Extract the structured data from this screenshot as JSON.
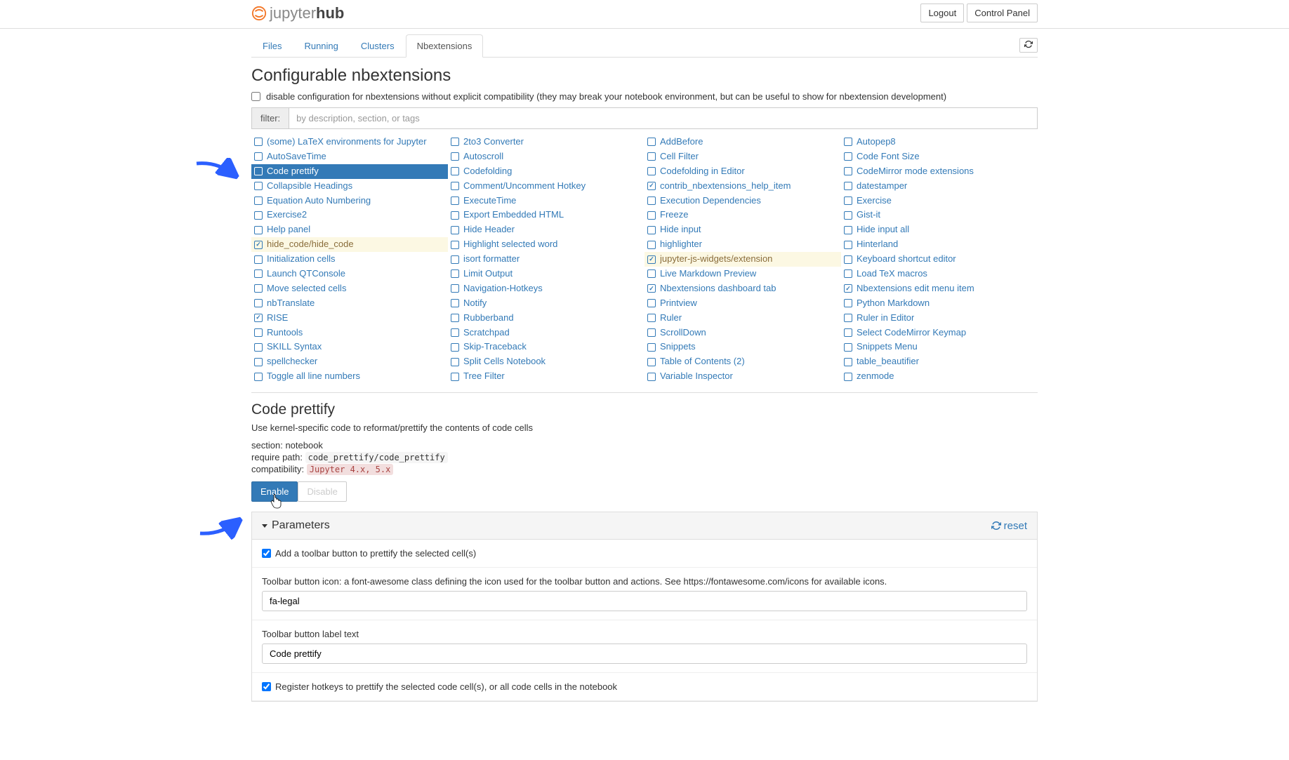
{
  "header": {
    "logo_prefix": "jupyter",
    "logo_suffix": "hub",
    "logout": "Logout",
    "control_panel": "Control Panel"
  },
  "tabs": [
    {
      "label": "Files",
      "active": false
    },
    {
      "label": "Running",
      "active": false
    },
    {
      "label": "Clusters",
      "active": false
    },
    {
      "label": "Nbextensions",
      "active": true
    }
  ],
  "page_title": "Configurable nbextensions",
  "compat_checkbox_label": "disable configuration for nbextensions without explicit compatibility (they may break your notebook environment, but can be useful to show for nbextension development)",
  "filter": {
    "label": "filter:",
    "placeholder": "by description, section, or tags"
  },
  "extensions": [
    {
      "name": "(some) LaTeX environments for Jupyter",
      "checked": false
    },
    {
      "name": "2to3 Converter",
      "checked": false
    },
    {
      "name": "AddBefore",
      "checked": false
    },
    {
      "name": "Autopep8",
      "checked": false
    },
    {
      "name": "AutoSaveTime",
      "checked": false
    },
    {
      "name": "Autoscroll",
      "checked": false
    },
    {
      "name": "Cell Filter",
      "checked": false
    },
    {
      "name": "Code Font Size",
      "checked": false
    },
    {
      "name": "Code prettify",
      "checked": false,
      "selected": true
    },
    {
      "name": "Codefolding",
      "checked": false
    },
    {
      "name": "Codefolding in Editor",
      "checked": false
    },
    {
      "name": "CodeMirror mode extensions",
      "checked": false
    },
    {
      "name": "Collapsible Headings",
      "checked": false
    },
    {
      "name": "Comment/Uncomment Hotkey",
      "checked": false
    },
    {
      "name": "contrib_nbextensions_help_item",
      "checked": true
    },
    {
      "name": "datestamper",
      "checked": false
    },
    {
      "name": "Equation Auto Numbering",
      "checked": false
    },
    {
      "name": "ExecuteTime",
      "checked": false
    },
    {
      "name": "Execution Dependencies",
      "checked": false
    },
    {
      "name": "Exercise",
      "checked": false
    },
    {
      "name": "Exercise2",
      "checked": false
    },
    {
      "name": "Export Embedded HTML",
      "checked": false
    },
    {
      "name": "Freeze",
      "checked": false
    },
    {
      "name": "Gist-it",
      "checked": false
    },
    {
      "name": "Help panel",
      "checked": false
    },
    {
      "name": "Hide Header",
      "checked": false
    },
    {
      "name": "Hide input",
      "checked": false
    },
    {
      "name": "Hide input all",
      "checked": false
    },
    {
      "name": "hide_code/hide_code",
      "checked": true,
      "highlight": true
    },
    {
      "name": "Highlight selected word",
      "checked": false
    },
    {
      "name": "highlighter",
      "checked": false
    },
    {
      "name": "Hinterland",
      "checked": false
    },
    {
      "name": "Initialization cells",
      "checked": false
    },
    {
      "name": "isort formatter",
      "checked": false
    },
    {
      "name": "jupyter-js-widgets/extension",
      "checked": true,
      "highlight": true
    },
    {
      "name": "Keyboard shortcut editor",
      "checked": false
    },
    {
      "name": "Launch QTConsole",
      "checked": false
    },
    {
      "name": "Limit Output",
      "checked": false
    },
    {
      "name": "Live Markdown Preview",
      "checked": false
    },
    {
      "name": "Load TeX macros",
      "checked": false
    },
    {
      "name": "Move selected cells",
      "checked": false
    },
    {
      "name": "Navigation-Hotkeys",
      "checked": false
    },
    {
      "name": "Nbextensions dashboard tab",
      "checked": true
    },
    {
      "name": "Nbextensions edit menu item",
      "checked": true
    },
    {
      "name": "nbTranslate",
      "checked": false
    },
    {
      "name": "Notify",
      "checked": false
    },
    {
      "name": "Printview",
      "checked": false
    },
    {
      "name": "Python Markdown",
      "checked": false
    },
    {
      "name": "RISE",
      "checked": true
    },
    {
      "name": "Rubberband",
      "checked": false
    },
    {
      "name": "Ruler",
      "checked": false
    },
    {
      "name": "Ruler in Editor",
      "checked": false
    },
    {
      "name": "Runtools",
      "checked": false
    },
    {
      "name": "Scratchpad",
      "checked": false
    },
    {
      "name": "ScrollDown",
      "checked": false
    },
    {
      "name": "Select CodeMirror Keymap",
      "checked": false
    },
    {
      "name": "SKILL Syntax",
      "checked": false
    },
    {
      "name": "Skip-Traceback",
      "checked": false
    },
    {
      "name": "Snippets",
      "checked": false
    },
    {
      "name": "Snippets Menu",
      "checked": false
    },
    {
      "name": "spellchecker",
      "checked": false
    },
    {
      "name": "Split Cells Notebook",
      "checked": false
    },
    {
      "name": "Table of Contents (2)",
      "checked": false
    },
    {
      "name": "table_beautifier",
      "checked": false
    },
    {
      "name": "Toggle all line numbers",
      "checked": false
    },
    {
      "name": "Tree Filter",
      "checked": false
    },
    {
      "name": "Variable Inspector",
      "checked": false
    },
    {
      "name": "zenmode",
      "checked": false
    }
  ],
  "detail": {
    "title": "Code prettify",
    "description": "Use kernel-specific code to reformat/prettify the contents of code cells",
    "section_label": "section:",
    "section_value": "notebook",
    "require_label": "require path:",
    "require_value": "code_prettify/code_prettify",
    "compat_label": "compatibility:",
    "compat_value": "Jupyter 4.x, 5.x",
    "enable": "Enable",
    "disable": "Disable"
  },
  "params": {
    "heading": "Parameters",
    "reset": "reset",
    "p1_label": "Add a toolbar button to prettify the selected cell(s)",
    "p1_checked": true,
    "p2_label": "Toolbar button icon: a font-awesome class defining the icon used for the toolbar button and actions. See https://fontawesome.com/icons for available icons.",
    "p2_value": "fa-legal",
    "p3_label": "Toolbar button label text",
    "p3_value": "Code prettify",
    "p4_label": "Register hotkeys to prettify the selected code cell(s), or all code cells in the notebook",
    "p4_checked": true
  }
}
